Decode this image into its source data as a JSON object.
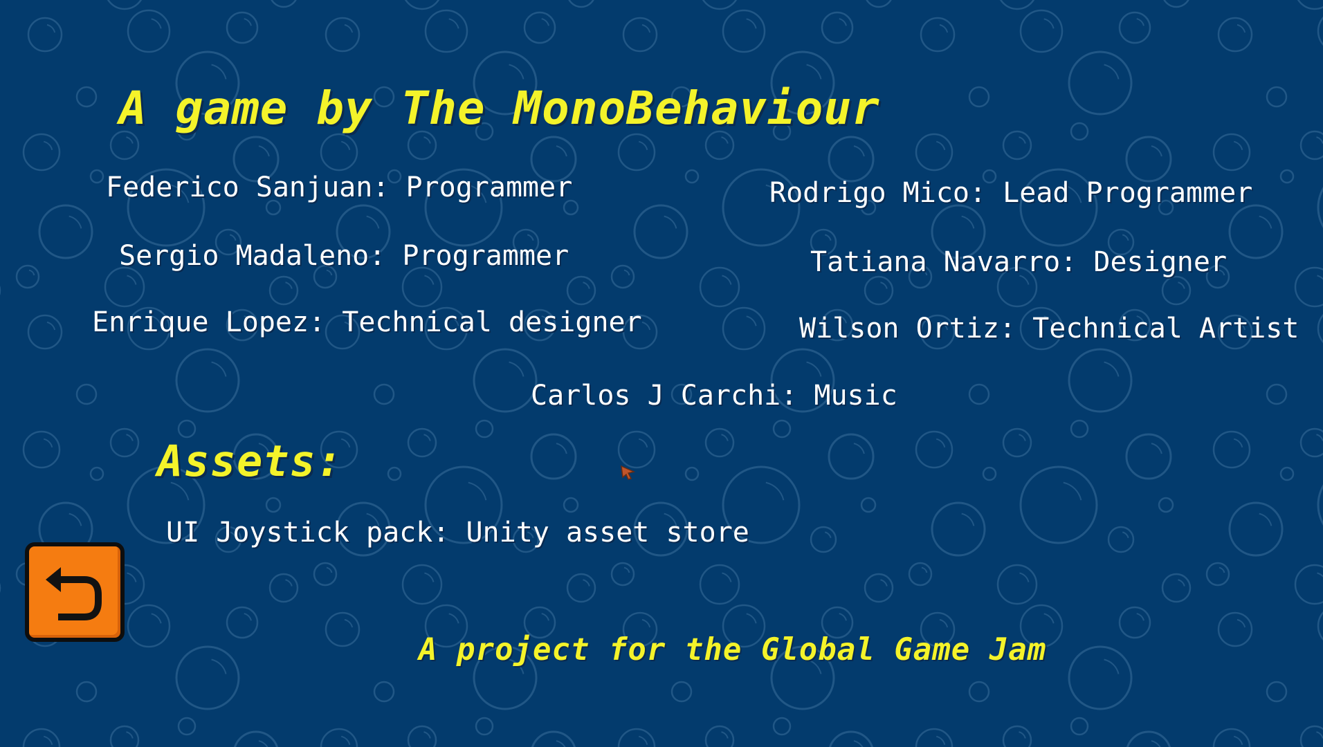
{
  "screen": "credits",
  "header": {
    "title": "A game by The MonoBehaviour"
  },
  "credits": {
    "left": [
      "Federico Sanjuan: Programmer",
      "Sergio Madaleno: Programmer",
      "Enrique Lopez: Technical designer"
    ],
    "right": [
      "Rodrigo Mico: Lead Programmer",
      "Tatiana Navarro: Designer",
      "Wilson Ortiz: Technical Artist"
    ],
    "center": "Carlos J Carchi: Music"
  },
  "assets": {
    "heading": "Assets:",
    "items": [
      "UI Joystick pack: Unity asset store"
    ]
  },
  "footer": {
    "text": "A project for the Global Game Jam"
  },
  "back_button": {
    "icon": "undo-arrow-icon"
  },
  "colors": {
    "background": "#033b6d",
    "bubble": "#3a6f9b",
    "title": "#f4f32a",
    "credit_text": "#ffffff",
    "back_button": "#f57c11"
  }
}
